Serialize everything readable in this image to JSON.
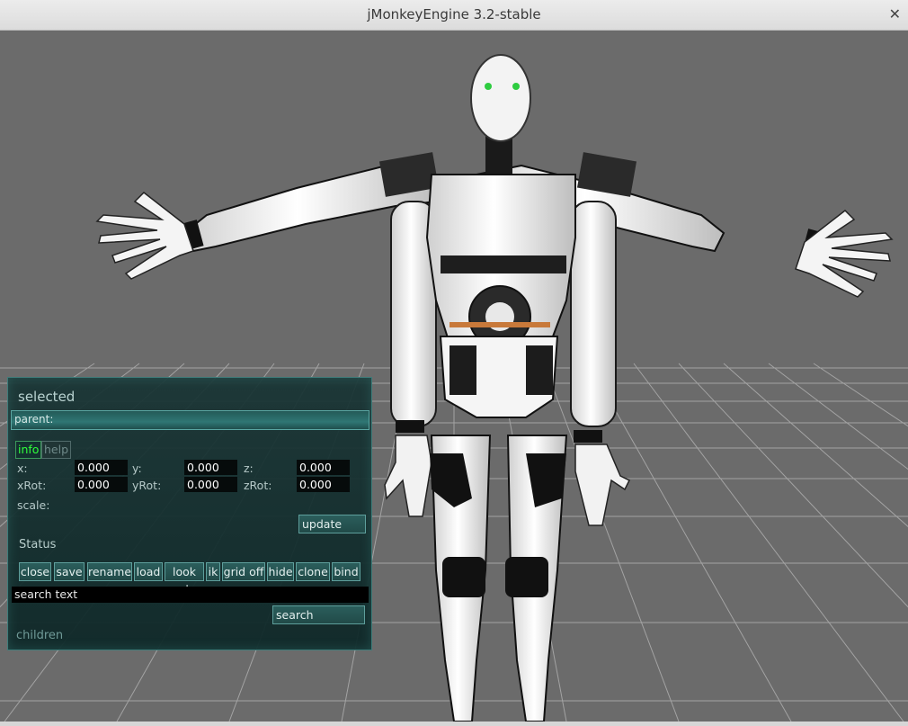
{
  "window": {
    "title": "jMonkeyEngine 3.2-stable",
    "close_glyph": "✕"
  },
  "viewport": {
    "background": "#6b6b6b",
    "grid_color": "#9a9a9a",
    "model": "humanoid robot (InMoov) in T-pose"
  },
  "panel": {
    "header": "selected",
    "parent_label": "parent:",
    "tabs": [
      {
        "label": "info",
        "active": true
      },
      {
        "label": "help",
        "active": false
      }
    ],
    "fields": {
      "x": {
        "label": "x:",
        "value": "0.000"
      },
      "y": {
        "label": "y:",
        "value": "0.000"
      },
      "z": {
        "label": "z:",
        "value": "0.000"
      },
      "xRot": {
        "label": "xRot:",
        "value": "0.000"
      },
      "yRot": {
        "label": "yRot:",
        "value": "0.000"
      },
      "zRot": {
        "label": "zRot:",
        "value": "0.000"
      }
    },
    "scale_label": "scale:",
    "update_label": "update",
    "status_label": "Status",
    "buttons": [
      "close",
      "save",
      "rename",
      "load",
      "look at",
      "ik",
      "grid off",
      "hide",
      "clone",
      "bind"
    ],
    "search_text": "search text",
    "search_label": "search",
    "children_label": "children"
  },
  "colors": {
    "panel_bg": "#183434",
    "panel_border": "#3f7c7a",
    "active_tab": "#2eff3a"
  }
}
